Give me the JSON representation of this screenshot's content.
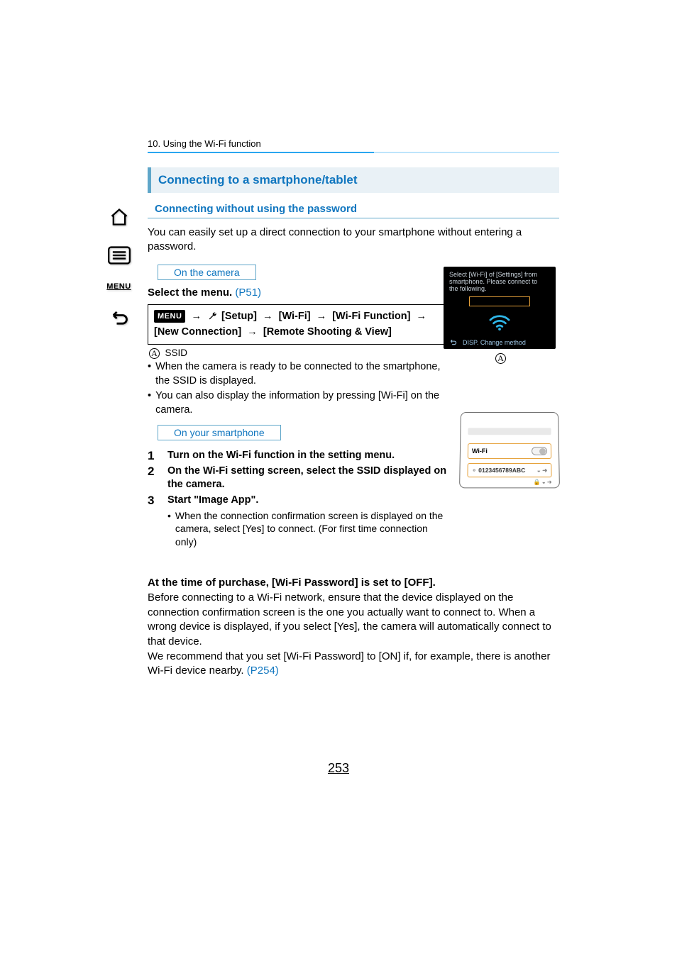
{
  "sidebar": {
    "menu_label": "MENU"
  },
  "chapter": "10. Using the Wi-Fi function",
  "section_title": "Connecting to a smartphone/tablet",
  "subsection_title": "Connecting without using the password",
  "intro": "You can easily set up a direct connection to your smartphone without entering a password.",
  "camera_label": "On the camera",
  "select_menu_prefix": "Select the menu. ",
  "select_menu_link": "(P51)",
  "menu_path": {
    "chip": "MENU",
    "line1_items": [
      "[Setup]",
      "[Wi-Fi]",
      "[Wi-Fi Function]"
    ],
    "line2_items": [
      "[New Connection]",
      "[Remote Shooting & View]"
    ]
  },
  "ssid_label": "SSID",
  "cam_bullets": [
    "When the camera is ready to be connected to the smartphone, the SSID is displayed.",
    "You can also display the information by pressing [Wi-Fi] on the camera."
  ],
  "phone_label": "On your smartphone",
  "steps": [
    {
      "n": "1",
      "text": "Turn on the Wi-Fi function in the setting menu."
    },
    {
      "n": "2",
      "text": "On the Wi-Fi setting screen, select the SSID displayed on the camera."
    },
    {
      "n": "3",
      "text": "Start \"Image App\".",
      "sub": "When the connection confirmation screen is displayed on the camera, select [Yes] to connect. (For first time connection only)"
    }
  ],
  "camera_fig": {
    "line1": "Select [Wi-Fi] of [Settings] from",
    "line2": "smartphone. Please connect to",
    "line3": "the following.",
    "change": "DISP. Change method",
    "marker": "A"
  },
  "phone_fig": {
    "wifi": "Wi-Fi",
    "ssid": "0123456789ABC"
  },
  "purchase_bold": "At the time of purchase, [Wi-Fi Password] is set to [OFF].",
  "purchase_body": "Before connecting to a Wi-Fi network, ensure that the device displayed on the connection confirmation screen is the one you actually want to connect to. When a wrong device is displayed, if you select [Yes], the camera will automatically connect to that device.\nWe recommend that you set [Wi-Fi Password] to [ON] if, for example, there is another Wi-Fi device nearby. ",
  "purchase_link": "(P254)",
  "page_number": "253"
}
